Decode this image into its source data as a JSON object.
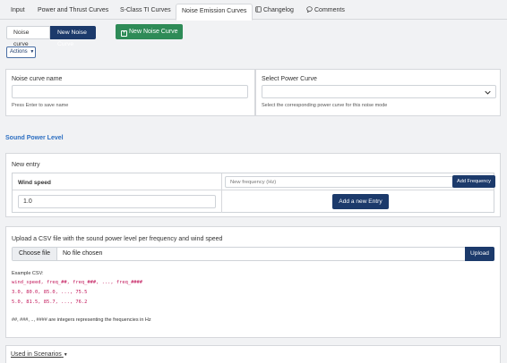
{
  "tabs": [
    {
      "label": "Input",
      "icon": ""
    },
    {
      "label": "Power and Thrust Curves",
      "icon": ""
    },
    {
      "label": "S-Class TI Curves",
      "icon": ""
    },
    {
      "label": "Noise Emission Curves",
      "icon": ""
    },
    {
      "label": "Changelog",
      "icon": "book-icon"
    },
    {
      "label": "Comments",
      "icon": "comment-icon"
    }
  ],
  "active_tab": "Noise Emission Curves",
  "toolbar": {
    "noise_curve_label": "Noise curve",
    "new_noise_curve_label": "New Noise Curve",
    "create_new_noise_curve_label": "New Noise Curve",
    "actions_label": "Actions"
  },
  "form": {
    "name_label": "Noise curve name",
    "name_value": "",
    "name_hint": "Press Enter to save name",
    "power_label": "Select Power Curve",
    "power_value": "",
    "power_hint": "Select the corresponding power curve for this noise mode"
  },
  "sound_power": {
    "title": "Sound Power Level",
    "new_entry_label": "New entry",
    "wind_speed_label": "Wind speed",
    "frequency_placeholder": "New frequency (Hz)",
    "add_frequency_label": "Add Frequency",
    "wind_speed_value": "1.0",
    "add_entry_label": "Add a new Entry"
  },
  "upload": {
    "title": "Upload a CSV file with the sound power level per frequency and wind speed",
    "choose_file_label": "Choose file",
    "no_file_label": "No file chosen",
    "upload_label": "Upload",
    "example_label": "Example CSV:",
    "example_lines": [
      "wind_speed, freq_##, freq_###, ..., freq_####",
      "3.0, 80.0, 85.0, ..., 75.5",
      "5.0, 81.5, 85.7, ..., 76.2"
    ],
    "note": "##, ###, .., #### are integers representing the frequencies in Hz"
  },
  "scenarios": {
    "label": "Used in Scenarios"
  },
  "colors": {
    "navy": "#1c3a6b",
    "green": "#2e8b57",
    "link_blue": "#2d6fc2",
    "code_pink": "#c2185b"
  }
}
